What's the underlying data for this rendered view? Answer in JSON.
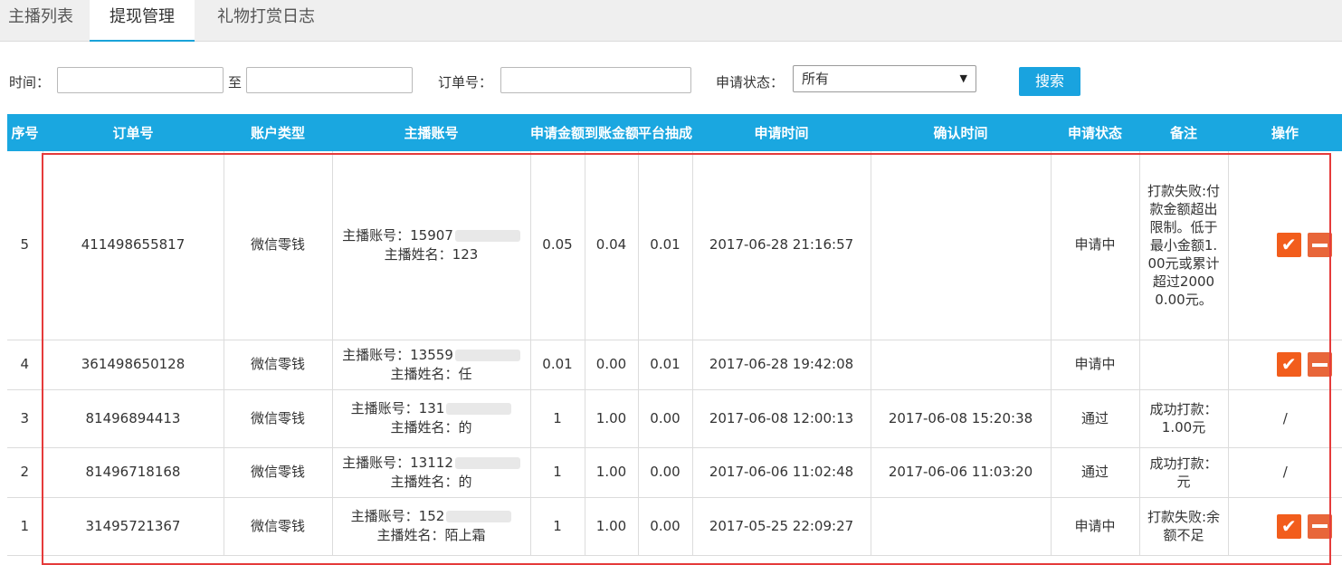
{
  "tabs": [
    {
      "label": "主播列表",
      "active": false
    },
    {
      "label": "提现管理",
      "active": true
    },
    {
      "label": "礼物打赏日志",
      "active": false
    }
  ],
  "filter": {
    "time_label": "时间：",
    "to_label": "至",
    "order_label": "订单号：",
    "status_label": "申请状态：",
    "status_selected": "所有",
    "search_label": "搜索"
  },
  "table": {
    "headers": [
      "序号",
      "订单号",
      "账户类型",
      "主播账号",
      "申请金额",
      "到账金额",
      "平台抽成",
      "申请时间",
      "确认时间",
      "申请状态",
      "备注",
      "操作"
    ],
    "rows": [
      {
        "seq": "5",
        "order": "411498655817",
        "type": "微信零钱",
        "account": "主播账号：15907",
        "name": "主播姓名：123",
        "amount": "0.05",
        "received": "0.04",
        "fee": "0.01",
        "apply_time": "2017-06-28 21:16:57",
        "confirm_time": "",
        "status": "申请中",
        "note": "打款失败:付款金额超出限制。低于最小金额1.00元或累计超过20000.00元。",
        "op": "buttons"
      },
      {
        "seq": "4",
        "order": "361498650128",
        "type": "微信零钱",
        "account": "主播账号：13559",
        "name": "主播姓名：任",
        "amount": "0.01",
        "received": "0.00",
        "fee": "0.01",
        "apply_time": "2017-06-28 19:42:08",
        "confirm_time": "",
        "status": "申请中",
        "note": "",
        "op": "buttons"
      },
      {
        "seq": "3",
        "order": "81496894413",
        "type": "微信零钱",
        "account": "主播账号：131",
        "name": "主播姓名：的",
        "amount": "1",
        "received": "1.00",
        "fee": "0.00",
        "apply_time": "2017-06-08 12:00:13",
        "confirm_time": "2017-06-08 15:20:38",
        "status": "通过",
        "note": "成功打款：1.00元",
        "op": "/"
      },
      {
        "seq": "2",
        "order": "81496718168",
        "type": "微信零钱",
        "account": "主播账号：13112",
        "name": "主播姓名：的",
        "amount": "1",
        "received": "1.00",
        "fee": "0.00",
        "apply_time": "2017-06-06 11:02:48",
        "confirm_time": "2017-06-06 11:03:20",
        "status": "通过",
        "note": "成功打款：元",
        "op": "/"
      },
      {
        "seq": "1",
        "order": "31495721367",
        "type": "微信零钱",
        "account": "主播账号：152",
        "name": "主播姓名：陌上霜",
        "amount": "1",
        "received": "1.00",
        "fee": "0.00",
        "apply_time": "2017-05-25 22:09:27",
        "confirm_time": "",
        "status": "申请中",
        "note": "打款失败:余额不足",
        "op": "buttons"
      }
    ]
  },
  "colors": {
    "accent": "#1aa7e0",
    "action": "#f25d1c",
    "highlight": "#e53b3b"
  }
}
